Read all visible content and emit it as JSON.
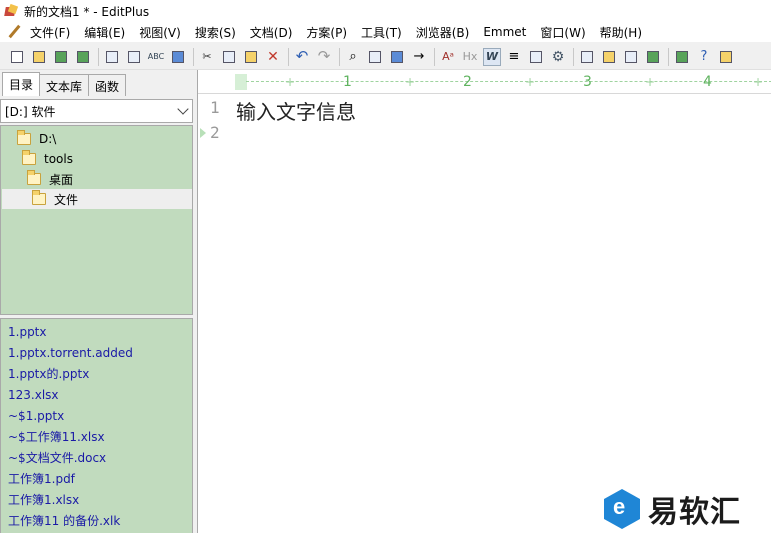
{
  "window": {
    "title": "新的文档1 * - EditPlus"
  },
  "menubar": {
    "items": [
      "文件(F)",
      "编辑(E)",
      "视图(V)",
      "搜索(S)",
      "文档(D)",
      "方案(P)",
      "工具(T)",
      "浏览器(B)",
      "Emmet",
      "窗口(W)",
      "帮助(H)"
    ]
  },
  "toolbar": {
    "icons": [
      "new-document-icon",
      "open-folder-icon",
      "save-icon",
      "save-all-icon",
      "print-preview-icon",
      "print-icon",
      "spellcheck-icon",
      "sync-icon",
      "cut-icon",
      "copy-icon",
      "paste-icon",
      "delete-icon",
      "undo-icon",
      "redo-icon",
      "find-icon",
      "replace-icon",
      "edit-icon",
      "goto-icon",
      "font-icon",
      "hx-icon",
      "wordwrap-icon",
      "indent-icon",
      "ruler-icon",
      "settings-icon",
      "view1-icon",
      "view2-icon",
      "view3-icon",
      "view4-icon",
      "browser-icon",
      "help-icon",
      "cliptext-icon"
    ],
    "font_glyph": "Aᵃ",
    "hx_glyph": "Hx",
    "wrap_glyph": "W",
    "abc_glyph": "ABC"
  },
  "sidebar": {
    "tabs": [
      "目录",
      "文本库",
      "函数"
    ],
    "active_tab": "目录",
    "drive": "[D:] 软件",
    "tree": [
      {
        "label": "D:\\",
        "level": 0
      },
      {
        "label": "tools",
        "level": 1
      },
      {
        "label": "桌面",
        "level": 2
      },
      {
        "label": "文件",
        "level": 3,
        "selected": true
      }
    ],
    "files": [
      "1.pptx",
      "1.pptx.torrent.added",
      "1.pptx的.pptx",
      "123.xlsx",
      "~$1.pptx",
      "~$工作簿11.xlsx",
      "~$文档文件.docx",
      "工作簿1.pdf",
      "工作簿1.xlsx",
      "工作簿11 的备份.xlk"
    ]
  },
  "editor": {
    "ruler_numbers": [
      "1",
      "2",
      "3",
      "4"
    ],
    "lines": [
      {
        "number": "1",
        "text": "输入文字信息"
      },
      {
        "number": "2",
        "text": ""
      }
    ]
  },
  "watermark": {
    "text": "易软汇",
    "logo_letter": "e"
  },
  "colors": {
    "sidebar_bg": "#c1dbbe",
    "file_link": "#1a1aa6",
    "ruler_green": "#5fb35f",
    "brand_blue": "#1f86d6"
  }
}
